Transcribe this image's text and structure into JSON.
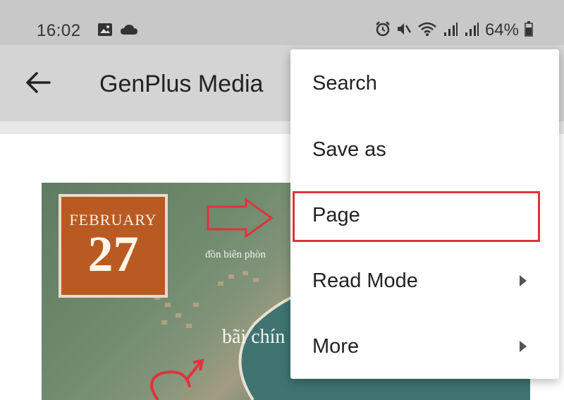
{
  "status_bar": {
    "time": "16:02",
    "battery": "64%",
    "icons": [
      "gallery-icon",
      "cloud-icon",
      "alarm-icon",
      "mute-icon",
      "wifi-icon",
      "signal-icon",
      "signal-icon",
      "battery-icon"
    ]
  },
  "app_bar": {
    "title": "GenPlus Media",
    "back_icon": "back-arrow-icon"
  },
  "page_image": {
    "date_month": "FEBRUARY",
    "date_day": "27",
    "label_1": "đồn biên phòn",
    "label_2": "bãi chín"
  },
  "menu": {
    "items": [
      {
        "label": "Search",
        "has_submenu": false
      },
      {
        "label": "Save as",
        "has_submenu": false
      },
      {
        "label": "Page",
        "has_submenu": false,
        "highlighted": true
      },
      {
        "label": "Read Mode",
        "has_submenu": true
      },
      {
        "label": "More",
        "has_submenu": true
      }
    ]
  },
  "colors": {
    "highlight": "#e0323d",
    "date_badge": "#b95a22"
  }
}
